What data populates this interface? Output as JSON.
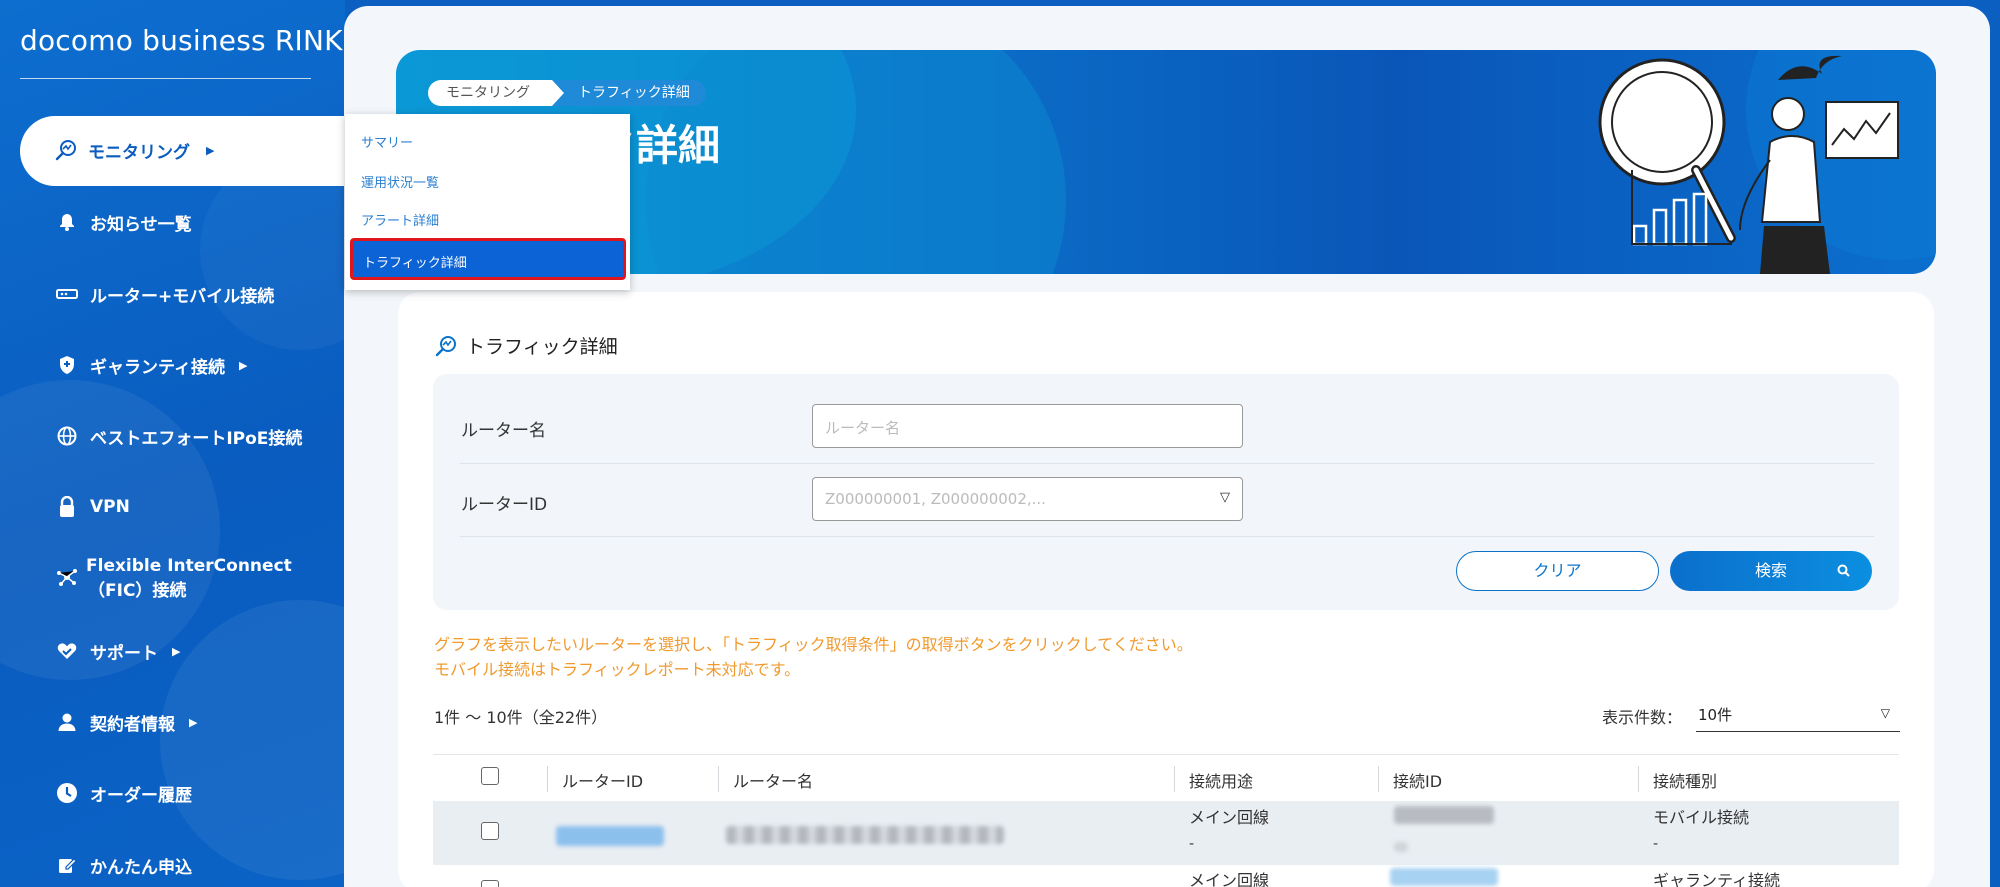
{
  "brand": "docomo business RINK",
  "sidebar": {
    "active_item": "モニタリング",
    "items": [
      {
        "label": "お知らせ一覧",
        "icon": "bell-icon"
      },
      {
        "label": "ルーター+モバイル接続",
        "icon": "router-icon"
      },
      {
        "label": "ギャランティ接続",
        "icon": "shield-icon",
        "has_submenu": true
      },
      {
        "label": "ベストエフォートIPoE接続",
        "icon": "globe-icon"
      },
      {
        "label": "VPN",
        "icon": "lock-icon"
      },
      {
        "label": "サポート",
        "icon": "support-icon",
        "has_submenu": true
      },
      {
        "label": "契約者情報",
        "icon": "person-icon",
        "has_submenu": true
      },
      {
        "label": "オーダー履歴",
        "icon": "clock-icon"
      },
      {
        "label": "かんたん申込",
        "icon": "edit-icon"
      }
    ],
    "fic_line1": "Flexible InterConnect",
    "fic_line2": "（FIC）接続"
  },
  "submenu": {
    "items": [
      "サマリー",
      "運用状況一覧",
      "アラート詳細",
      "トラフィック詳細"
    ],
    "selected": "トラフィック詳細"
  },
  "breadcrumb": {
    "parent": "モニタリング",
    "current": "トラフィック詳細"
  },
  "hero": {
    "title_visible": "ク詳細"
  },
  "card": {
    "title": "トラフィック詳細"
  },
  "form": {
    "router_name_label": "ルーター名",
    "router_name_placeholder": "ルーター名",
    "router_id_label": "ルーターID",
    "router_id_placeholder": "Z000000001, Z000000002,...",
    "clear_label": "クリア",
    "search_label": "検索"
  },
  "notes": {
    "line1": "グラフを表示したいルーターを選択し、「トラフィック取得条件」の取得ボタンをクリックしてください。",
    "line2": "モバイル接続はトラフィックレポート未対応です。"
  },
  "results": {
    "count_text": "1件 ～ 10件（全22件）",
    "per_page_label": "表示件数：",
    "per_page_value": "10件"
  },
  "table": {
    "headers": [
      "ルーターID",
      "ルーター名",
      "接続用途",
      "接続ID",
      "接続種別"
    ],
    "rows": [
      {
        "usage": "メイン回線",
        "usage2": "-",
        "type": "モバイル接続",
        "type2": "-"
      },
      {
        "usage": "メイン回線",
        "type": "ギャランティ接続"
      }
    ]
  },
  "colors": {
    "brand_blue": "#0b5cbf",
    "accent_blue": "#0b73c9",
    "note_orange": "#f09a2e",
    "highlight_red": "#e0161d"
  }
}
